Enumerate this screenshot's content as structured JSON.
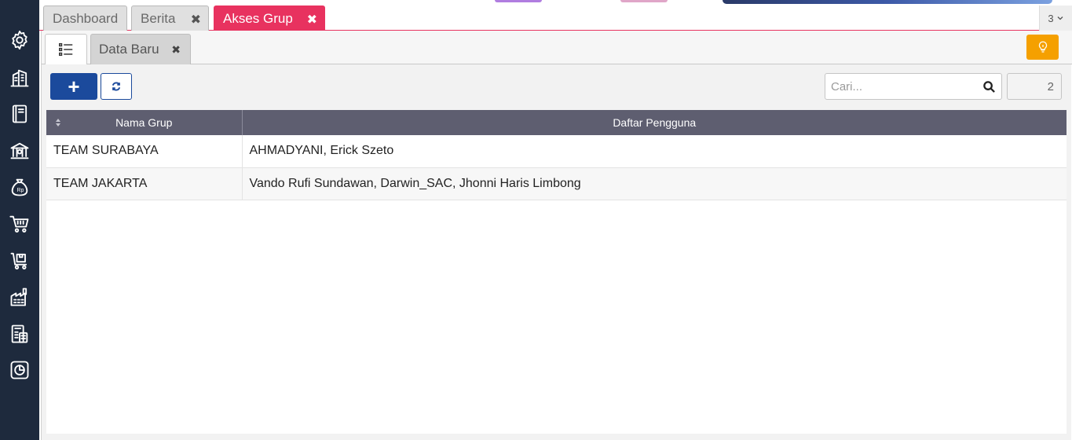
{
  "sidebar": {
    "icons": [
      "gear-icon",
      "building-icon",
      "book-icon",
      "bank-icon",
      "money-bag-icon",
      "cart-icon",
      "cart-box-icon",
      "factory-icon",
      "tax-calculator-icon",
      "report-chart-icon"
    ]
  },
  "tabs": [
    {
      "label": "Dashboard",
      "closable": false,
      "active": false
    },
    {
      "label": "Berita",
      "closable": true,
      "active": false
    },
    {
      "label": "Akses Grup",
      "closable": true,
      "active": true
    }
  ],
  "tab_count": "3",
  "subtabs": {
    "list_icon": "list-icon",
    "data_label": "Data Baru"
  },
  "toolbar": {
    "add_label": "+",
    "search_placeholder": "Cari...",
    "record_count": "2"
  },
  "table": {
    "columns": [
      "Nama Grup",
      "Daftar Pengguna"
    ],
    "rows": [
      [
        "TEAM SURABAYA",
        "AHMADYANI, Erick Szeto"
      ],
      [
        "TEAM JAKARTA",
        "Vando Rufi Sundawan, Darwin_SAC, Jhonni Haris Limbong"
      ]
    ]
  },
  "colors": {
    "sidebar": "#1e2a3d",
    "active_tab": "#e8325f",
    "primary": "#1b4a9c",
    "warning": "#f5a000",
    "table_header": "#5e5e70"
  }
}
